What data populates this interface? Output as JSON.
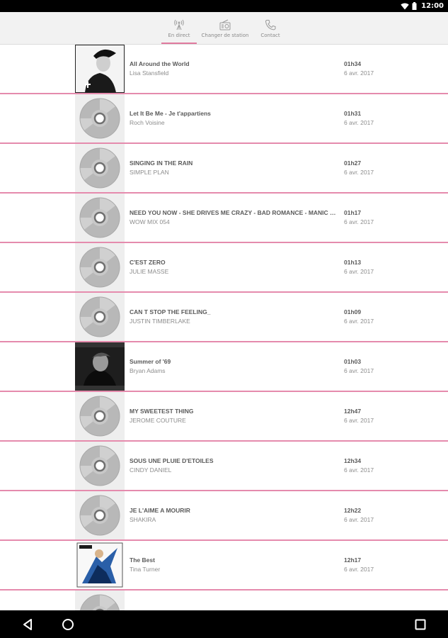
{
  "status_bar": {
    "time": "12:00",
    "icons": [
      "wifi-icon",
      "battery-icon"
    ]
  },
  "tabs": [
    {
      "label": "En direct",
      "icon": "antenna-icon",
      "active": true
    },
    {
      "label": "Changer de station",
      "icon": "radio-icon",
      "active": false
    },
    {
      "label": "Contact",
      "icon": "phone-icon",
      "active": false
    }
  ],
  "colors": {
    "accent": "#e58bad",
    "tab_indicator": "#e07a9e"
  },
  "tracks": [
    {
      "title": "All Around the World",
      "artist": "Lisa Stansfield",
      "time": "01h34",
      "date": "6 avr. 2017",
      "cover": "album-art"
    },
    {
      "title": "Let It Be Me - Je t'appartiens",
      "artist": "Roch Voisine",
      "time": "01h31",
      "date": "6 avr. 2017",
      "cover": "cd-icon"
    },
    {
      "title": "SINGING IN THE RAIN",
      "artist": "SIMPLE PLAN",
      "time": "01h27",
      "date": "6 avr. 2017",
      "cover": "cd-icon"
    },
    {
      "title": "NEED YOU NOW - SHE DRIVES ME CRAZY - BAD ROMANCE - MANIC MON...",
      "artist": "WOW MIX 054",
      "time": "01h17",
      "date": "6 avr. 2017",
      "cover": "cd-icon"
    },
    {
      "title": "C'EST ZERO",
      "artist": "JULIE MASSE",
      "time": "01h13",
      "date": "6 avr. 2017",
      "cover": "cd-icon"
    },
    {
      "title": "CAN T STOP THE FEELING_",
      "artist": "JUSTIN TIMBERLAKE",
      "time": "01h09",
      "date": "6 avr. 2017",
      "cover": "cd-icon"
    },
    {
      "title": "Summer of '69",
      "artist": "Bryan Adams",
      "time": "01h03",
      "date": "6 avr. 2017",
      "cover": "album-art"
    },
    {
      "title": "MY SWEETEST THING",
      "artist": "JEROME COUTURE",
      "time": "12h47",
      "date": "6 avr. 2017",
      "cover": "cd-icon"
    },
    {
      "title": "SOUS UNE PLUIE D'ETOILES",
      "artist": "CINDY DANIEL",
      "time": "12h34",
      "date": "6 avr. 2017",
      "cover": "cd-icon"
    },
    {
      "title": "JE L'AIME A MOURIR",
      "artist": "SHAKIRA",
      "time": "12h22",
      "date": "6 avr. 2017",
      "cover": "cd-icon"
    },
    {
      "title": "The Best",
      "artist": "Tina Turner",
      "time": "12h17",
      "date": "6 avr. 2017",
      "cover": "album-art"
    },
    {
      "title": "",
      "artist": "",
      "time": "",
      "date": "",
      "cover": "cd-icon"
    }
  ],
  "nav_bar": {
    "buttons": [
      "back-icon",
      "home-icon",
      "recents-icon"
    ]
  }
}
